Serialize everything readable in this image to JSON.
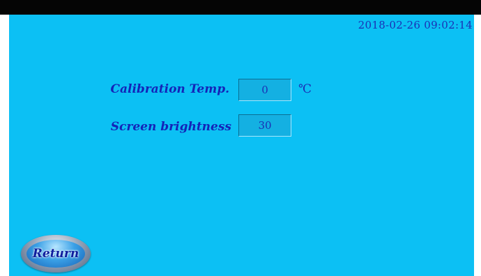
{
  "status": {
    "datetime": "2018-02-26 09:02:14"
  },
  "settings": {
    "calibration_temp": {
      "label": "Calibration Temp.",
      "value": "0",
      "unit": "℃"
    },
    "screen_brightness": {
      "label": "Screen brightness",
      "value": "30"
    }
  },
  "nav": {
    "return_label": "Return"
  },
  "colors": {
    "background": "#0cc0f4",
    "text": "#1424b8",
    "field": "#14b0e2"
  }
}
